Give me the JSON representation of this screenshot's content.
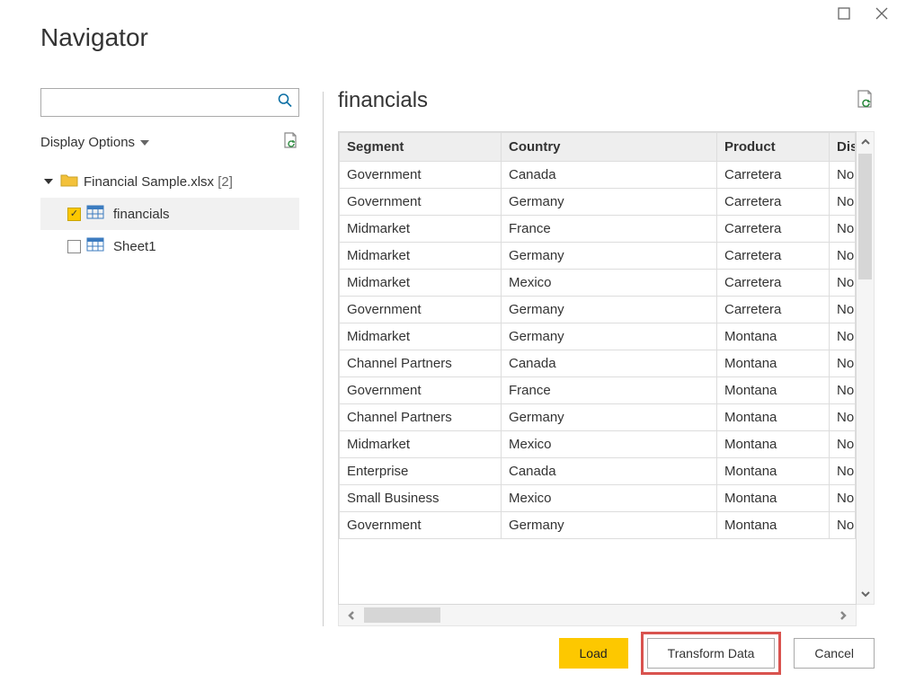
{
  "window": {
    "title": "Navigator"
  },
  "left": {
    "search_placeholder": "",
    "display_options_label": "Display Options",
    "tree": {
      "root": {
        "label": "Financial Sample.xlsx",
        "suffix": "[2]"
      },
      "items": [
        {
          "label": "financials",
          "checked": true,
          "selected": true
        },
        {
          "label": "Sheet1",
          "checked": false,
          "selected": false
        }
      ]
    }
  },
  "preview": {
    "title": "financials",
    "columns": [
      "Segment",
      "Country",
      "Product",
      "Discou"
    ],
    "last_col_truncated_value": "No",
    "rows": [
      {
        "segment": "Government",
        "country": "Canada",
        "product": "Carretera"
      },
      {
        "segment": "Government",
        "country": "Germany",
        "product": "Carretera"
      },
      {
        "segment": "Midmarket",
        "country": "France",
        "product": "Carretera"
      },
      {
        "segment": "Midmarket",
        "country": "Germany",
        "product": "Carretera"
      },
      {
        "segment": "Midmarket",
        "country": "Mexico",
        "product": "Carretera"
      },
      {
        "segment": "Government",
        "country": "Germany",
        "product": "Carretera"
      },
      {
        "segment": "Midmarket",
        "country": "Germany",
        "product": "Montana"
      },
      {
        "segment": "Channel Partners",
        "country": "Canada",
        "product": "Montana"
      },
      {
        "segment": "Government",
        "country": "France",
        "product": "Montana"
      },
      {
        "segment": "Channel Partners",
        "country": "Germany",
        "product": "Montana"
      },
      {
        "segment": "Midmarket",
        "country": "Mexico",
        "product": "Montana"
      },
      {
        "segment": "Enterprise",
        "country": "Canada",
        "product": "Montana"
      },
      {
        "segment": "Small Business",
        "country": "Mexico",
        "product": "Montana"
      },
      {
        "segment": "Government",
        "country": "Germany",
        "product": "Montana"
      }
    ]
  },
  "footer": {
    "load": "Load",
    "transform": "Transform Data",
    "cancel": "Cancel"
  }
}
